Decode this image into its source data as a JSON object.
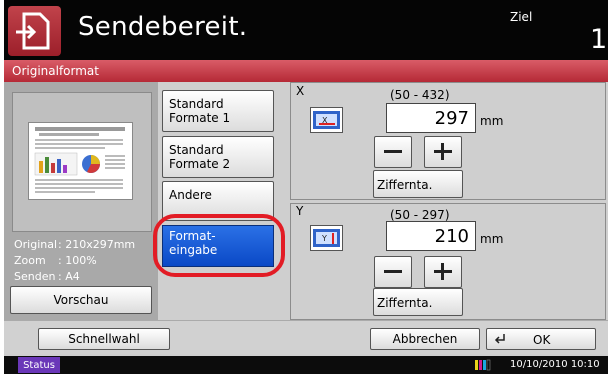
{
  "header": {
    "title": "Sendebereit.",
    "ziel_label": "Ziel",
    "ziel_count": "1"
  },
  "tab": {
    "label": "Originalformat"
  },
  "preview": {
    "original_label": "Original",
    "original_value": ": 210x297mm",
    "zoom_label": "Zoom",
    "zoom_value": ": 100%",
    "senden_label": "Senden",
    "senden_value": ": A4",
    "vorschau_button": "Vorschau"
  },
  "format_buttons": {
    "standard1_line1": "Standard",
    "standard1_line2": "Formate 1",
    "standard2_line1": "Standard",
    "standard2_line2": "Formate 2",
    "andere": "Andere",
    "formateingabe_line1": "Format-",
    "formateingabe_line2": "eingabe"
  },
  "x_section": {
    "label": "X",
    "range": "(50 - 432)",
    "value": "297",
    "unit": "mm",
    "ziffern_button": "Ziffernta."
  },
  "y_section": {
    "label": "Y",
    "range": "(50 - 297)",
    "value": "210",
    "unit": "mm",
    "ziffern_button": "Ziffernta."
  },
  "bottom": {
    "schnellwahl": "Schnellwahl",
    "abbrechen": "Abbrechen",
    "ok": "OK"
  },
  "status": {
    "status_button": "Status",
    "datetime": "10/10/2010  10:10"
  },
  "colors": {
    "accent_red": "#b52936",
    "selected_blue": "#0a49c6",
    "highlight_ring": "#e21c25",
    "status_purple": "#6a37b8"
  },
  "icons": {
    "header": "send-document-icon",
    "x_field": "format-x-icon",
    "y_field": "format-y-icon",
    "ok": "enter-arrow-icon",
    "status_bar": "toner-icon"
  }
}
